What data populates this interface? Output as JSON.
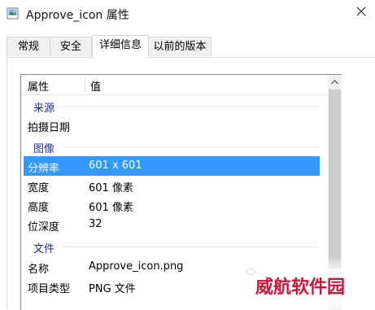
{
  "window": {
    "title": "Approve_icon 属性",
    "icon": "image-file-icon",
    "close_glyph": "✕"
  },
  "tabs": [
    {
      "label": "常规",
      "active": false
    },
    {
      "label": "安全",
      "active": false
    },
    {
      "label": "详细信息",
      "active": true
    },
    {
      "label": "以前的版本",
      "active": false
    }
  ],
  "details": {
    "header": {
      "property": "属性",
      "value": "值"
    },
    "groups": {
      "source": "来源",
      "image": "图像",
      "file": "文件"
    },
    "rows": {
      "date_taken": {
        "property": "拍摄日期",
        "value": ""
      },
      "resolution": {
        "property": "分辨率",
        "value": "601 x 601",
        "selected": true
      },
      "width": {
        "property": "宽度",
        "value": "601 像素"
      },
      "height": {
        "property": "高度",
        "value": "601 像素"
      },
      "bit_depth": {
        "property": "位深度",
        "value": "32"
      },
      "name": {
        "property": "名称",
        "value": "Approve_icon.png"
      },
      "item_type": {
        "property": "项目类型",
        "value": "PNG 文件"
      }
    }
  },
  "watermark": {
    "text": "威航软件园",
    "color": "#c8183a"
  },
  "colors": {
    "selection": "#3399ff",
    "group_header": "#1e3287",
    "tab_inactive": "#f0f0f0"
  }
}
